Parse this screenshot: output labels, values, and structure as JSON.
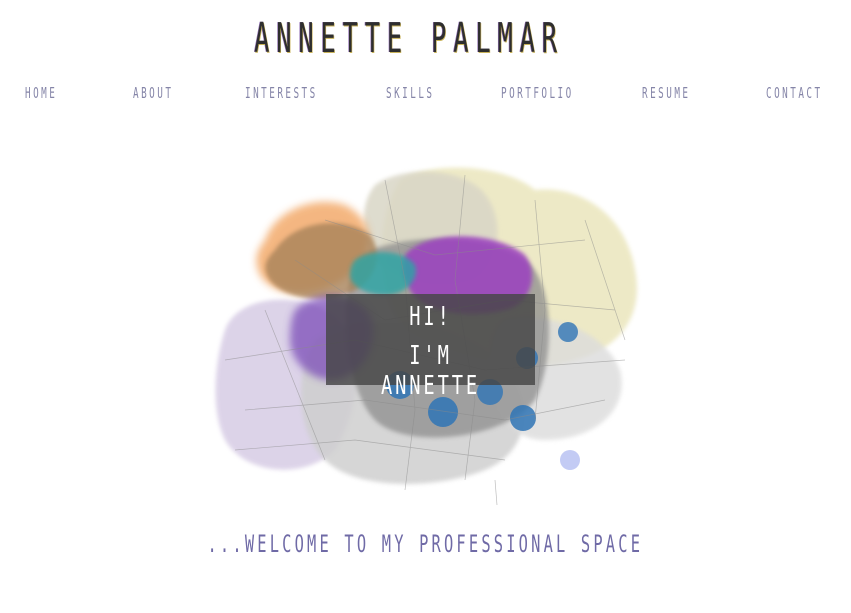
{
  "site": {
    "title": "ANNETTE PALMAR",
    "accent_color": "#6f6aa6",
    "nav_color": "#8585a8"
  },
  "nav": {
    "items": [
      {
        "label": "HOME"
      },
      {
        "label": "ABOUT"
      },
      {
        "label": "INTERESTS"
      },
      {
        "label": "SKILLS"
      },
      {
        "label": "PORTFOLIO"
      },
      {
        "label": "RESUME"
      },
      {
        "label": "CONTACT"
      }
    ]
  },
  "hero": {
    "image_icon": "watercolor-map-brain-illustration",
    "greeting_line1": "HI!",
    "greeting_line2": "I'M ANNETTE"
  },
  "footer": {
    "welcome": "...WELCOME TO MY PROFESSIONAL SPACE"
  }
}
